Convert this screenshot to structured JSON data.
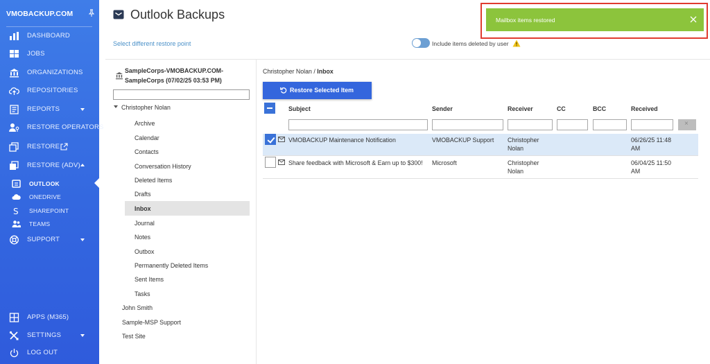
{
  "sidebar": {
    "brand": "VMOBACKUP.COM",
    "items": [
      {
        "label": "DASHBOARD"
      },
      {
        "label": "JOBS"
      },
      {
        "label": "ORGANIZATIONS"
      },
      {
        "label": "REPOSITORIES"
      },
      {
        "label": "REPORTS"
      },
      {
        "label": "RESTORE OPERATORS"
      },
      {
        "label": "RESTORE"
      },
      {
        "label": "RESTORE (ADV)"
      },
      {
        "label": "SUPPORT"
      }
    ],
    "sub_items": [
      {
        "label": "OUTLOOK"
      },
      {
        "label": "ONEDRIVE"
      },
      {
        "label": "SHAREPOINT"
      },
      {
        "label": "TEAMS"
      }
    ],
    "bottom_items": [
      {
        "label": "APPS (M365)"
      },
      {
        "label": "SETTINGS"
      },
      {
        "label": "LOG OUT"
      }
    ]
  },
  "header": {
    "title": "Outlook Backups",
    "restore_point_link": "Select different restore point",
    "include_deleted_label": "Include items deleted by user"
  },
  "toast": {
    "message": "Mailbox items restored"
  },
  "tree": {
    "source_line1": "SampleCorps-VMOBACKUP.COM-",
    "source_line2": "SampleCorps (07/02/25 03:53 PM)",
    "user": "Christopher Nolan",
    "folders": [
      "Archive",
      "Calendar",
      "Contacts",
      "Conversation History",
      "Deleted Items",
      "Drafts",
      "Inbox",
      "Journal",
      "Notes",
      "Outbox",
      "Permanently Deleted Items",
      "Sent Items",
      "Tasks"
    ],
    "other_users": [
      "John Smith",
      "Sample-MSP Support",
      "Test Site"
    ]
  },
  "grid": {
    "breadcrumb_user": "Christopher Nolan",
    "breadcrumb_sep": " / ",
    "breadcrumb_folder": "Inbox",
    "restore_button": "Restore Selected Item",
    "columns": [
      "Subject",
      "Sender",
      "Receiver",
      "CC",
      "BCC",
      "Received"
    ],
    "rows": [
      {
        "subject": "VMOBACKUP Maintenance Notification",
        "sender": "VMOBACKUP Support",
        "receiver_1": "Christopher",
        "receiver_2": "Nolan",
        "received_1": "06/26/25 11:48",
        "received_2": "AM"
      },
      {
        "subject": "Share feedback with Microsoft & Earn up to $300!",
        "sender": "Microsoft",
        "receiver_1": "Christopher",
        "receiver_2": "Nolan",
        "received_1": "06/04/25 11:50",
        "received_2": "AM"
      }
    ]
  },
  "colors": {
    "sidebar": "#3468e0",
    "accent": "#3466dd",
    "toast": "#8cc43c",
    "highlight_frame": "#e03b2f",
    "row_selected": "#dbe9f8"
  }
}
